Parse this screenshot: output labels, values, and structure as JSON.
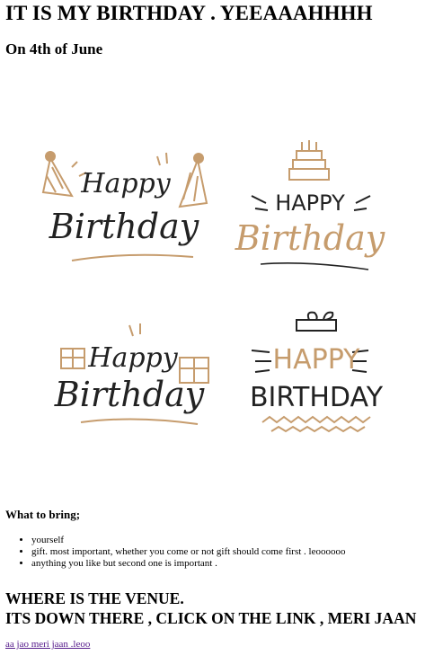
{
  "page": {
    "title": "IT IS MY BIRTHDAY . YEEAAAHHHH",
    "subtitle": "On 4th of June"
  },
  "hero_image": {
    "badges": [
      {
        "line1": "Happy",
        "line2": "Birthday",
        "style": "script",
        "decoration": "party-hats"
      },
      {
        "line1": "HAPPY",
        "line2": "Birthday",
        "style": "caps-script",
        "decoration": "cake"
      },
      {
        "line1": "Happy",
        "line2": "Birthday",
        "style": "script",
        "decoration": "gifts"
      },
      {
        "line1": "HAPPY",
        "line2": "BIRTHDAY",
        "style": "caps",
        "decoration": "gift-box"
      }
    ],
    "colors": {
      "ink": "#222222",
      "gold": "#c69c6d"
    }
  },
  "bring": {
    "heading": "What to bring;",
    "items": [
      "yourself",
      "gift. most important, whether you come or not gift should come first . leoooooo",
      "anything you like but second one is important ."
    ]
  },
  "venue": {
    "line1": "WHERE IS THE VENUE.",
    "line2": "ITS DOWN THERE , CLICK ON THE LINK , MERI JAAN",
    "link_text": "aa jao meri jaan .leoo"
  }
}
